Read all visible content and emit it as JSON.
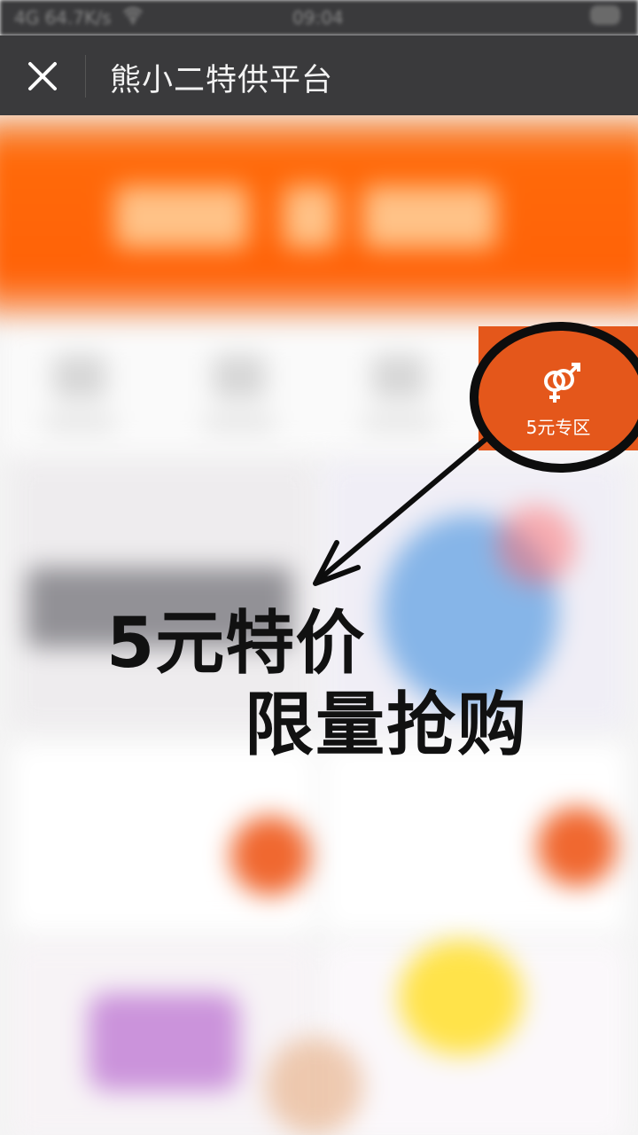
{
  "status_bar": {
    "speed": "4G 64.7K/s",
    "time": "09:04"
  },
  "nav": {
    "title": "熊小二特供平台"
  },
  "zone": {
    "label": "5元专区"
  },
  "annotation": {
    "line1": "5元特价",
    "line2": "限量抢购"
  },
  "colors": {
    "accent": "#e4571b",
    "banner": "#ff6208",
    "nav_bg": "#3a3a3c"
  }
}
